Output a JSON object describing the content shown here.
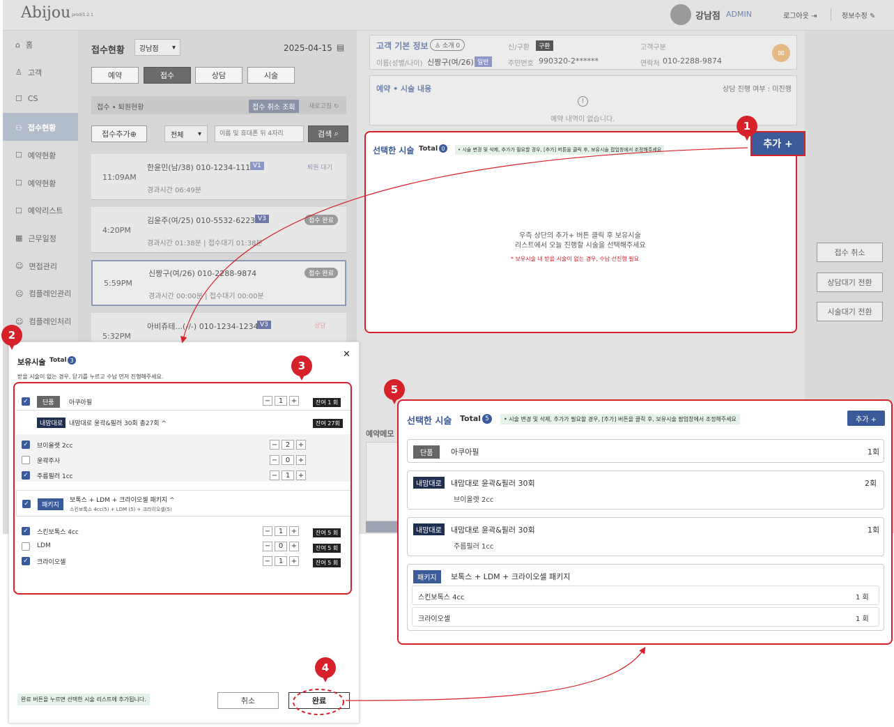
{
  "header": {
    "logo": "Abijou",
    "version": "prod/1.2.1",
    "user": "강남점",
    "role": "ADMIN",
    "logout": "로그아웃",
    "profile": "정보수정"
  },
  "sidebar": {
    "items": [
      "홈",
      "고객",
      "CS",
      "접수현황",
      "예약현황",
      "예약현황",
      "예약리스트",
      "근무일정",
      "면접관리",
      "컴플레인관리",
      "컴플레인처리"
    ]
  },
  "list": {
    "title": "접수현황",
    "branch": "강남점",
    "date": "2025-04-15",
    "tabs": [
      "예약",
      "접수",
      "상담",
      "시술"
    ],
    "section": "접수 • 퇴원현황",
    "cancel_view": "접수 취소 조회",
    "refresh": "새로고침",
    "add": "접수추가",
    "filter": "전체",
    "search_ph": "이름 및 휴대폰 뒤 4자리",
    "search": "검색",
    "cards": [
      {
        "time": "11:09AM",
        "name": "한윤민(남/38) 010-1234-1111",
        "badge": "V1",
        "status": "퇴원 대기",
        "sub": "경과시간 06:49분"
      },
      {
        "time": "4:20PM",
        "name": "김윤주(여/25) 010-5532-6223",
        "badge": "V3",
        "status": "접수 완료",
        "sub": "경과시간 01:38분 | 접수대기 01:38분"
      },
      {
        "time": "5:59PM",
        "name": "신짱구(여/26) 010-2288-9874",
        "badge": "",
        "status": "접수 완료",
        "sub": "경과시간 00:00분 | 접수대기 00:00분"
      },
      {
        "time": "5:32PM",
        "name": "아비쥬테...(-/-) 010-1234-1234",
        "badge": "V3",
        "status": "상담",
        "sub": ""
      }
    ]
  },
  "customer": {
    "title": "고객 기본 정보",
    "intro": "소개 0",
    "type_label": "신/구환",
    "type": "구환",
    "cat_label": "고객구분",
    "name_label": "이름(성별/나이)",
    "name": "신짱구(여/26)",
    "grade": "일반",
    "rrn_label": "주민번호",
    "rrn": "990320-2******",
    "phone_label": "연락처",
    "phone": "010-2288-9874"
  },
  "booking": {
    "title": "예약 • 시술 내용",
    "status": "상담 진행 여부 : 미진행",
    "empty": "예약 내역이 없습니다."
  },
  "selected": {
    "title": "선택한 시술",
    "total": "Total",
    "count": "0",
    "note": "• 시술 변경 및 삭제, 추가가 필요할 경우, [추가] 버튼을 클릭 후, 보유시술 팝업창에서 조정해주세요",
    "add": "추가 +",
    "guide1": "우측 상단의 추가+ 버튼 클릭 후 보유시술",
    "guide2": "리스트에서 오늘 진행할 시술을 선택해주세요",
    "guide3": "* 보유시술 내 받을 시술이 없는 경우, 수납 선진행 필요"
  },
  "side_buttons": [
    "접수 취소",
    "상담대기 전환",
    "시술대기 전환"
  ],
  "memo": "예약메모",
  "popup": {
    "title": "보유시술",
    "total": "Total",
    "count": "3",
    "desc": "받을 시술이 없는 경우, 닫기를 누르고 수납 먼저 진행해주세요.",
    "close": "✕",
    "item1": {
      "tag": "단품",
      "name": "아쿠아필",
      "qty": "1",
      "remain": "잔여 1 회"
    },
    "group1": {
      "tag": "내맘대로",
      "name": "내맘대로 윤곽&필러 30회 총27회",
      "remain": "잔여 27회",
      "subs": [
        {
          "name": "브이올렛 2cc",
          "qty": "2",
          "checked": true
        },
        {
          "name": "윤곽주사",
          "qty": "0",
          "checked": false
        },
        {
          "name": "주름필러 1cc",
          "qty": "1",
          "checked": true
        }
      ]
    },
    "group2": {
      "tag": "패키지",
      "name": "보톡스 + LDM + 크라이오셀 패키지",
      "desc": "스킨보톡스 4cc(5) + LDM (5) + 크라이오셀(5)",
      "subs": [
        {
          "name": "스킨보톡스 4cc",
          "qty": "1",
          "remain": "잔여 5 회",
          "checked": true
        },
        {
          "name": "LDM",
          "qty": "0",
          "remain": "잔여 5 회",
          "checked": false
        },
        {
          "name": "크라이오셀",
          "qty": "1",
          "remain": "잔여 5 회",
          "checked": true
        }
      ]
    },
    "footer_note": "완료 버튼을 누르면 선택한 시술 리스트에 추가됩니다.",
    "cancel": "취소",
    "done": "완료"
  },
  "result": {
    "title": "선택한 시술",
    "total": "Total",
    "count": "5",
    "note": "• 시술 변경 및 삭제, 추가가 필요할 경우, [추가] 버튼을 클릭 후, 보유시술 팝업창에서 조정해주세요",
    "add": "추가 +",
    "rows": [
      {
        "tag": "단품",
        "name": "아쿠아필",
        "sub": "",
        "cnt": "1회"
      },
      {
        "tag": "내맘대로",
        "name": "내맘대로 윤곽&필러 30회",
        "sub": "브이올렛 2cc",
        "cnt": "2회"
      },
      {
        "tag": "내맘대로",
        "name": "내맘대로 윤곽&필러 30회",
        "sub": "주름필러 1cc",
        "cnt": "1회"
      }
    ],
    "pkg": {
      "tag": "패키지",
      "name": "보톡스 + LDM + 크라이오셀 패키지",
      "subs": [
        {
          "name": "스킨보톡스 4cc",
          "cnt": "1 회"
        },
        {
          "name": "크라이오셀",
          "cnt": "1 회"
        }
      ]
    }
  },
  "markers": [
    "1",
    "2",
    "3",
    "4",
    "5"
  ],
  "colors": {
    "accent": "#3a5a9a",
    "red": "#d6202a",
    "navy": "#1f2f4f"
  }
}
